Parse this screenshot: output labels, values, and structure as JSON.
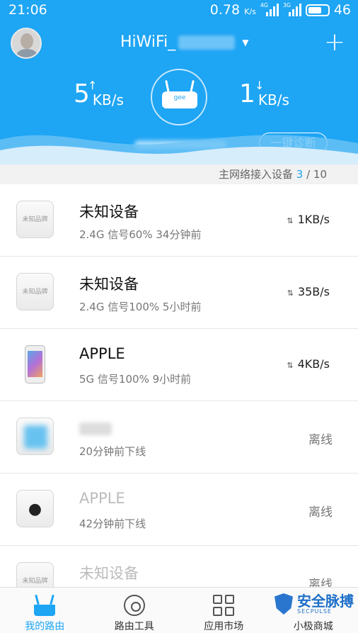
{
  "status_bar": {
    "time": "21:06",
    "net_speed": "0.78",
    "net_unit": "K/s",
    "sig1_label": "4G",
    "sig2_label": "3G",
    "battery": "46"
  },
  "header": {
    "ssid": "HiWiFi_",
    "upload": {
      "value": "5",
      "unit": "KB/s"
    },
    "download": {
      "value": "1",
      "unit": "KB/s"
    },
    "router_label": "gee",
    "diag_button": "一键诊断",
    "colors": {
      "primary": "#1ea5f4"
    }
  },
  "summary": {
    "label": "主网络接入设备",
    "current": "3",
    "separator": " / ",
    "total": "10"
  },
  "devices": [
    {
      "name": "未知设备",
      "thumb": "未知品牌",
      "meta": "2.4G  信号60%  34分钟前",
      "rate": "1KB/s",
      "status": "online"
    },
    {
      "name": "未知设备",
      "thumb": "未知品牌",
      "meta": "2.4G  信号100%  5小时前",
      "rate": "35B/s",
      "status": "online"
    },
    {
      "name": "APPLE",
      "thumb": "iphone-icon",
      "meta": "5G  信号100%  9小时前",
      "rate": "4KB/s",
      "status": "online"
    },
    {
      "name": "",
      "thumb": "blurred",
      "meta": "20分钟前下线",
      "state_label": "离线",
      "status": "offline"
    },
    {
      "name": "APPLE",
      "thumb": "apple-logo-icon",
      "meta": "42分钟前下线",
      "state_label": "离线",
      "status": "offline"
    },
    {
      "name": "未知设备",
      "thumb": "未知品牌",
      "meta": "",
      "state_label": "离线",
      "status": "offline"
    }
  ],
  "nav": [
    {
      "label": "我的路由",
      "icon": "router-icon",
      "active": true
    },
    {
      "label": "路由工具",
      "icon": "gear-icon",
      "active": false
    },
    {
      "label": "应用市场",
      "icon": "apps-grid-icon",
      "active": false
    },
    {
      "label": "小极商城",
      "icon": "shop-icon",
      "active": false
    }
  ],
  "watermark": {
    "title": "安全脉搏",
    "sub": "SECPULSE"
  }
}
